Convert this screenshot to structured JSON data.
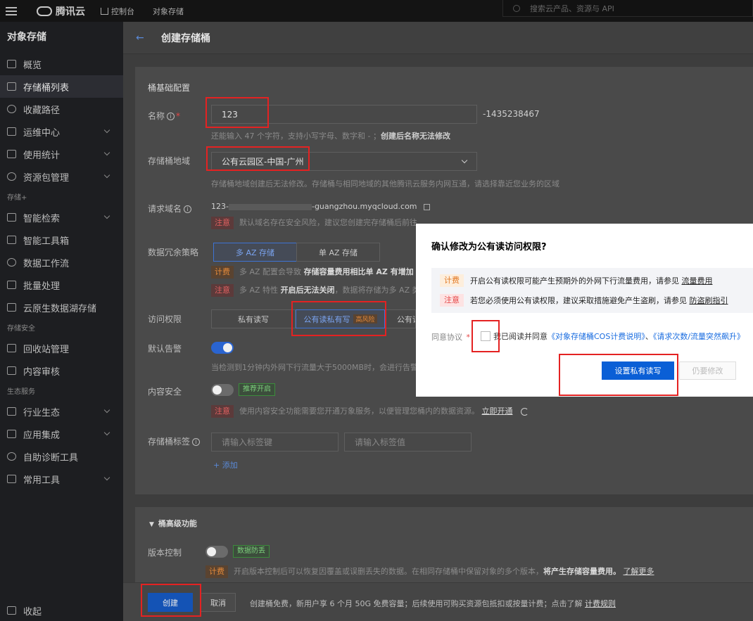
{
  "topbar": {
    "brand": "腾讯云",
    "nav": [
      "控制台",
      "对象存储"
    ],
    "search_placeholder": "搜索云产品、资源与 API"
  },
  "sidebar": {
    "title": "对象存储",
    "items": [
      {
        "label": "概览",
        "chevron": false
      },
      {
        "label": "存储桶列表",
        "chevron": false,
        "active": true
      },
      {
        "label": "收藏路径",
        "chevron": false
      },
      {
        "label": "运维中心",
        "chevron": true
      },
      {
        "label": "使用统计",
        "chevron": true
      },
      {
        "label": "资源包管理",
        "chevron": true
      }
    ],
    "group_storage": "存储+",
    "items2": [
      {
        "label": "智能检索",
        "chevron": true
      },
      {
        "label": "智能工具箱",
        "chevron": false
      },
      {
        "label": "数据工作流",
        "chevron": false
      },
      {
        "label": "批量处理",
        "chevron": false
      },
      {
        "label": "云原生数据湖存储",
        "chevron": false
      }
    ],
    "group_security": "存储安全",
    "items3": [
      {
        "label": "回收站管理",
        "chevron": false
      },
      {
        "label": "内容审核",
        "chevron": false
      }
    ],
    "group_eco": "生态服务",
    "items4": [
      {
        "label": "行业生态",
        "chevron": true
      },
      {
        "label": "应用集成",
        "chevron": true
      },
      {
        "label": "自助诊断工具",
        "chevron": false
      },
      {
        "label": "常用工具",
        "chevron": true
      }
    ],
    "collapse": "收起"
  },
  "page": {
    "title": "创建存储桶"
  },
  "form": {
    "section_title": "桶基础配置",
    "name_label": "名称",
    "name_value": "123",
    "name_suffix": "-1435238467",
    "name_hint": "还能输入 47 个字符，支持小写字母、数字和 - ；",
    "name_hint_bold": "创建后名称无法修改",
    "region_label": "存储桶地域",
    "region_value": "公有云园区-中国-广州",
    "region_hint": "存储桶地域创建后无法修改。存储桶与相同地域的其他腾讯云服务内网互通，请选择靠近您业务的区域",
    "domain_label": "请求域名",
    "domain_value": "123-",
    "domain_value_tail": "-guangzhou.myqcloud.com",
    "domain_note_tag": "注意",
    "domain_note": "默认域名存在安全风险，建议您创建完存储桶后前往配置自定义域名，了解更多",
    "redundancy_label": "数据冗余策略",
    "redundancy_options": [
      "多 AZ 存储",
      "单 AZ 存储"
    ],
    "redundancy_note1_tag": "计费",
    "redundancy_note1": "多 AZ 配置会导致",
    "redundancy_note1_bold": "存储容量费用相比单 AZ 有增加",
    "redundancy_note2_tag": "注意",
    "redundancy_note2": "多 AZ 特性",
    "redundancy_note2_bold": "开启后无法关闭",
    "redundancy_note2_tail": "，数据将存储为多 AZ 类",
    "access_label": "访问权限",
    "access_options": [
      "私有读写",
      "公有读私有写",
      "公有读"
    ],
    "access_risk_tag": "高风险",
    "alarm_label": "默认告警",
    "alarm_hint": "当检测到1分钟内外网下行流量大于5000MB时，会进行告警通",
    "content_label": "内容安全",
    "content_tag": "推荐开启",
    "content_note_tag": "注意",
    "content_note": "使用内容安全功能需要您开通万象服务，以便管理您桶内的数据资源。",
    "content_note_link": "立即开通",
    "tags_label": "存储桶标签",
    "tag_key_placeholder": "请输入标签键",
    "tag_value_placeholder": "请输入标签值",
    "add_label": "+ 添加"
  },
  "advanced": {
    "title": "桶高级功能",
    "version_label": "版本控制",
    "version_tag": "数据防丢",
    "version_note_tag": "计费",
    "version_note": "开启版本控制后可以恢复因覆盖或误删丢失的数据。在相同存储桶中保留对象的多个版本，",
    "version_note_bold": "将产生存储容量费用。",
    "version_note_link": "了解更多"
  },
  "footer": {
    "create": "创建",
    "cancel": "取消",
    "info": "创建桶免费，新用户享 6 个月 50G 免费容量；后续使用可购买资源包抵扣或按量计费；点击了解",
    "info_link": "计费规则"
  },
  "modal": {
    "title": "确认修改为公有读访问权限?",
    "note1_tag": "计费",
    "note1": "开启公有读权限可能产生预期外的外网下行流量费用，请参见",
    "note1_link": "流量费用",
    "note2_tag": "注意",
    "note2": "若您必须使用公有读权限，建议采取措施避免产生盗刷，请参见",
    "note2_link": "防盗刷指引",
    "agree_label": "同意协议",
    "agree_text": "我已阅读并同意",
    "agree_link1": "《对象存储桶COS计费说明》",
    "agree_sep": "、",
    "agree_link2": "《请求次数/流量突然飙升》",
    "confirm": "设置私有读写",
    "still": "仍要修改"
  },
  "colors": {
    "highlight": "#e42222",
    "primary": "#0a5fd6"
  }
}
